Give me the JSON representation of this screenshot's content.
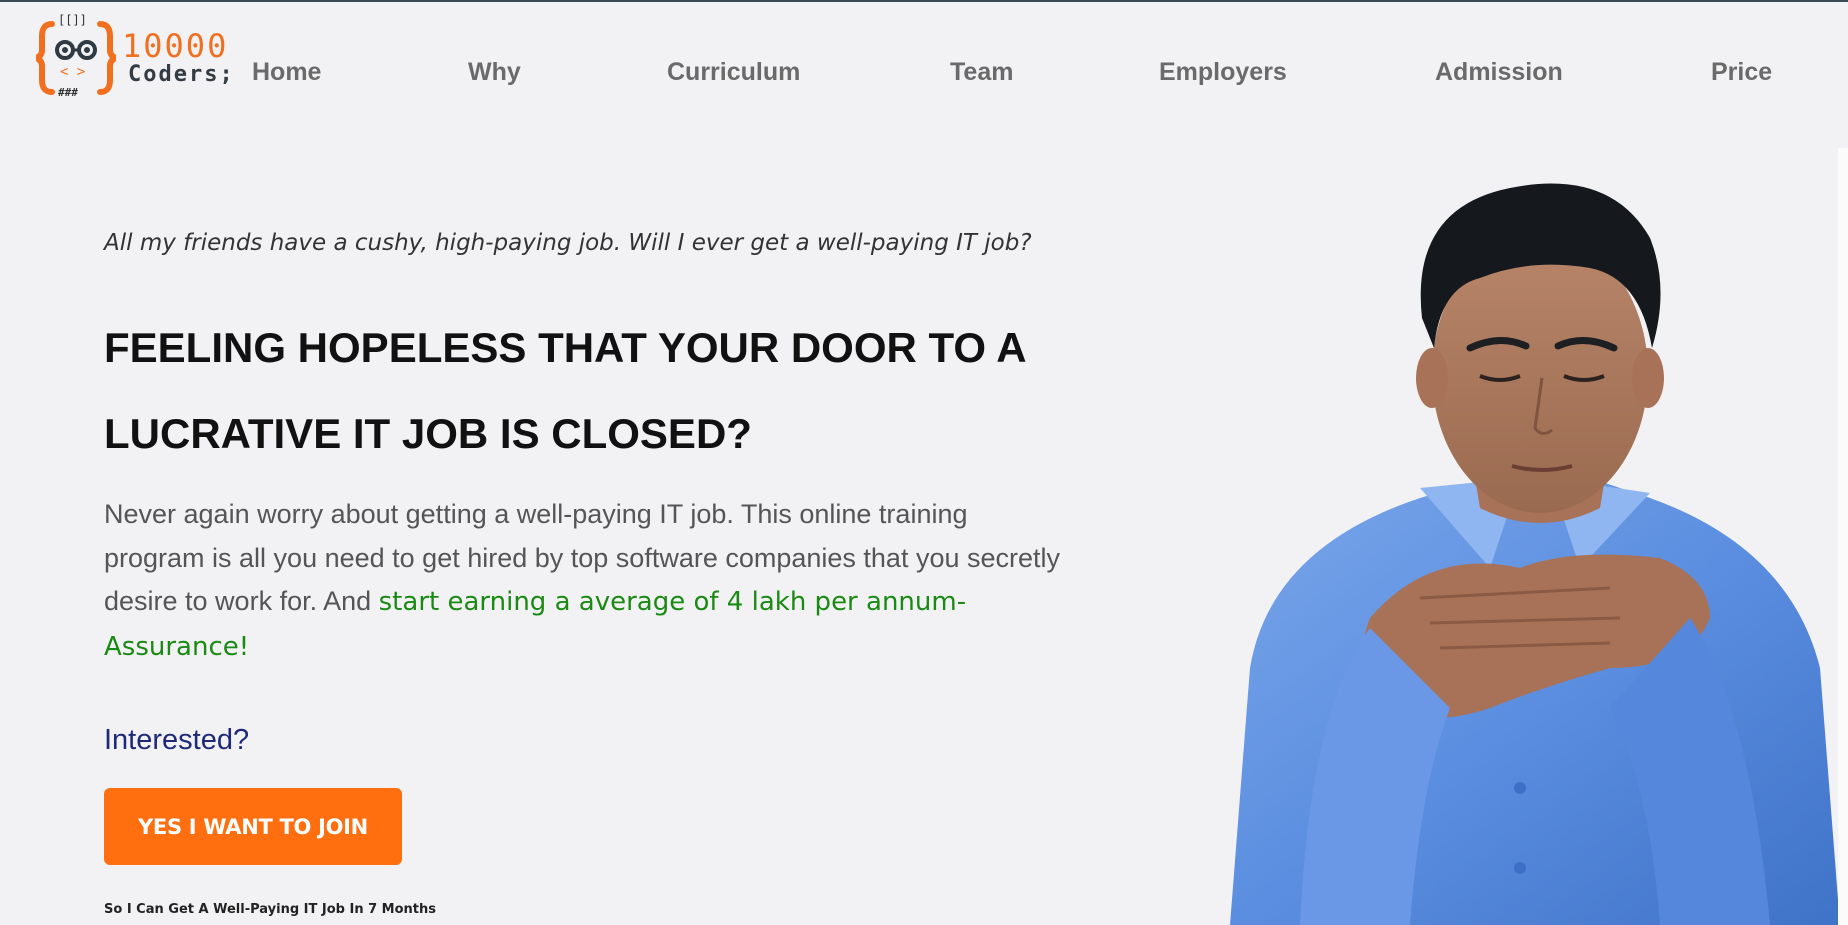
{
  "brand": {
    "logo_top": "10000",
    "logo_bottom": "Coders;",
    "accent_color": "#ff6f0f"
  },
  "nav": {
    "items": [
      {
        "label": "Home"
      },
      {
        "label": "Why"
      },
      {
        "label": "Curriculum"
      },
      {
        "label": "Team"
      },
      {
        "label": "Employers"
      },
      {
        "label": "Admission"
      },
      {
        "label": "Price"
      }
    ]
  },
  "hero": {
    "eyebrow": "All my friends have a cushy, high-paying job. Will I ever get a well-paying IT job?",
    "headline": "FEELING HOPELESS THAT YOUR DOOR TO A LUCRATIVE IT JOB IS CLOSED?",
    "body_intro": "Never again worry about getting a well-paying IT job. This online training program is all you need to get hired by top software companies that you secretly desire to work for. And ",
    "body_highlight": "start earning a average of 4 lakh per annum-Assurance!",
    "highlight_color": "#1b8a14",
    "interested": "Interested?",
    "cta_label": "YES I WANT TO JOIN",
    "cta_sub": "So I Can Get A Well-Paying IT Job In 7 Months",
    "image_icon": "thinking-man-photo"
  }
}
